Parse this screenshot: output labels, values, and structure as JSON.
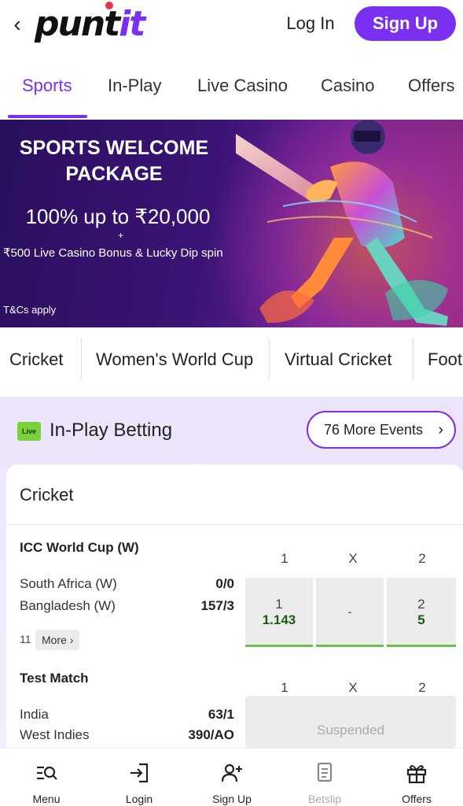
{
  "header": {
    "logo_part1": "punt",
    "logo_part2": "it",
    "login_label": "Log In",
    "signup_label": "Sign Up"
  },
  "tabs": [
    {
      "label": "Sports",
      "active": true
    },
    {
      "label": "In-Play"
    },
    {
      "label": "Live Casino"
    },
    {
      "label": "Casino"
    },
    {
      "label": "Offers"
    }
  ],
  "banner": {
    "title_line1": "SPORTS WELCOME",
    "title_line2": "PACKAGE",
    "offer": "100% up to ₹20,000",
    "plus": "+",
    "bonus": "₹500 Live Casino Bonus & Lucky Dip spin",
    "terms": "T&Cs apply"
  },
  "sport_chips": [
    "Cricket",
    "Women's World Cup",
    "Virtual Cricket",
    "Foot"
  ],
  "inplay": {
    "live_badge": "Live",
    "title": "In-Play Betting",
    "more_events": "76 More Events",
    "card_title": "Cricket",
    "matches": [
      {
        "competition": "ICC World Cup (W)",
        "col1": "1",
        "colx": "X",
        "col2": "2",
        "team1": "South Africa (W)",
        "score1": "0/0",
        "team2": "Bangladesh (W)",
        "score2": "157/3",
        "odds": {
          "home_label": "1",
          "home_value": "1.143",
          "draw": "-",
          "away_label": "2",
          "away_value": "5"
        },
        "markets_count": "11",
        "more_label": "More"
      },
      {
        "competition": "Test Match",
        "col1": "1",
        "colx": "X",
        "col2": "2",
        "team1": "India",
        "score1": "63/1",
        "team2": "West Indies",
        "score2": "390/AO",
        "status": "Suspended"
      }
    ]
  },
  "bottom_nav": [
    {
      "label": "Menu",
      "icon": "menu-search-icon"
    },
    {
      "label": "Login",
      "icon": "login-icon"
    },
    {
      "label": "Sign Up",
      "icon": "add-user-icon"
    },
    {
      "label": "Betslip",
      "icon": "betslip-icon",
      "disabled": true
    },
    {
      "label": "Offers",
      "icon": "gift-icon"
    }
  ],
  "colors": {
    "brand": "#7b2ff0",
    "live_green": "#7ad13a",
    "odds_green": "#6cc04a"
  }
}
